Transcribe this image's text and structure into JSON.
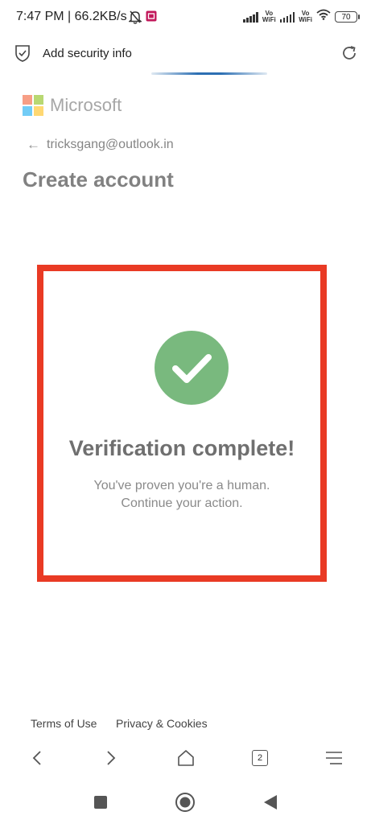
{
  "status_bar": {
    "time_speed": "7:47 PM | 66.2KB/s",
    "volte_1": "Vo\nWiFi",
    "volte_2": "Vo\nWiFi",
    "battery": "70"
  },
  "browser": {
    "tab_title": "Add security info",
    "page_load_progress": 0.5
  },
  "signup": {
    "brand": "Microsoft",
    "back_email": "tricksgang@outlook.in",
    "title": "Create account"
  },
  "verification": {
    "heading": "Verification complete!",
    "message_line1": "You've proven you're a human.",
    "message_line2": "Continue your action.",
    "check_color": "#79b97e",
    "highlight_color": "#e93a24"
  },
  "footer": {
    "terms": "Terms of Use",
    "privacy": "Privacy & Cookies"
  },
  "toolbar": {
    "tab_count": "2"
  },
  "colors": {
    "ms_red": "#f25022",
    "ms_green": "#7fba00",
    "ms_blue": "#00a4ef",
    "ms_yellow": "#ffb900"
  }
}
